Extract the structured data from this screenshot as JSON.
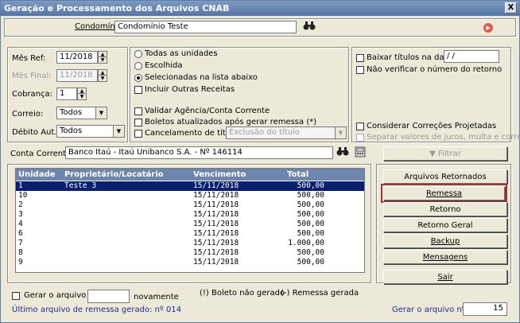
{
  "window": {
    "title": "Geração e Processamento dos Arquivos CNAB",
    "close": "X"
  },
  "condominio": {
    "label": "Condomínio:",
    "value": "Condomínio Teste"
  },
  "filtros": {
    "mes_ref": {
      "label": "Mês Ref:",
      "value": "11/2018"
    },
    "mes_final": {
      "label": "Mês Final:",
      "value": "11/2018"
    },
    "cobranca": {
      "label": "Cobrança:",
      "value": "1"
    },
    "correio": {
      "label": "Correio:",
      "value": "Todos"
    },
    "debito_aut": {
      "label": "Débito Aut.:",
      "value": "Todos"
    }
  },
  "unidades": {
    "opcoes": [
      "Todas as unidades",
      "Escolhida",
      "Selecionadas na lista abaixo"
    ],
    "selecionada": 2,
    "incluir_outras": "Incluir Outras Receitas",
    "validar": "Validar Agência/Conta Corrente",
    "boletos_atualizados": "Boletos atualizados após gerar remessa (*)",
    "cancelamento": {
      "label": "Cancelamento de título",
      "value": "Exclusão do título"
    }
  },
  "opcoes_direita": {
    "baixar": {
      "label": "Baixar títulos na data:",
      "value": " / /"
    },
    "nao_verificar": "Não verificar o número do retorno",
    "correcoes": "Considerar Correções Projetadas",
    "separar": "Separar valores de juros, multa e correção"
  },
  "conta_corrente": {
    "label": "Conta Corrente:",
    "value": "Banco Itaú - Itaú Unibanco S.A. - Nº 146114"
  },
  "filtrar_button": "Filtrar",
  "table": {
    "headers": [
      "Unidade",
      "Proprietário/Locatário",
      "Vencimento",
      "Total"
    ],
    "rows": [
      {
        "unidade": "1",
        "nome": "Teste 3",
        "venc": "15/11/2018",
        "total": "500,00"
      },
      {
        "unidade": "10",
        "nome": "",
        "venc": "15/11/2018",
        "total": "500,00"
      },
      {
        "unidade": "2",
        "nome": "",
        "venc": "15/11/2018",
        "total": "500,00"
      },
      {
        "unidade": "3",
        "nome": "",
        "venc": "15/11/2018",
        "total": "500,00"
      },
      {
        "unidade": "4",
        "nome": "",
        "venc": "15/11/2018",
        "total": "500,00"
      },
      {
        "unidade": "6",
        "nome": "",
        "venc": "15/11/2018",
        "total": "500,00"
      },
      {
        "unidade": "7",
        "nome": "",
        "venc": "15/11/2018",
        "total": "1.000,00"
      },
      {
        "unidade": "8",
        "nome": "",
        "venc": "15/11/2018",
        "total": "500,00"
      },
      {
        "unidade": "9",
        "nome": "",
        "venc": "15/11/2018",
        "total": "500,00"
      }
    ]
  },
  "side_buttons": [
    "Arquivos Retornados",
    "Remessa",
    "Retorno",
    "Retorno Geral",
    "Backup",
    "Mensagens",
    "Sair"
  ],
  "footer": {
    "gerar_arquivo": "Gerar o arquivo",
    "novamente": "novamente",
    "gerar_value": "",
    "legend_nao_gerado": "(!) Boleto não gerado",
    "legend_remessa": "(-) Remessa gerada",
    "ultimo": "Último arquivo de remessa gerado: nº 014",
    "gerar_n_label": "Gerar o arquivo nº:",
    "gerar_n_value": "15"
  },
  "colors": {
    "title_bar": "#5576a6",
    "selection": "#0a1f6f",
    "highlight": "#b0302f"
  }
}
